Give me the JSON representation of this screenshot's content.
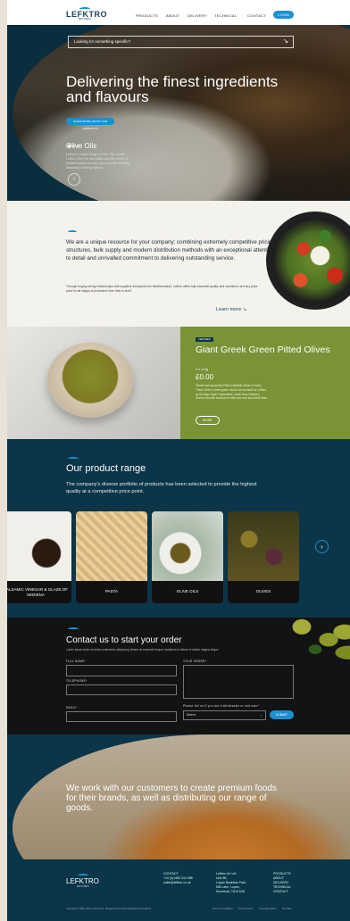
{
  "header": {
    "logo_text": "LEFKTRO",
    "logo_sub": "BROTHERS",
    "nav": [
      "PRODUCTS",
      "ABOUT",
      "DELIVERY",
      "TECHNICAL",
      "CONTACT"
    ],
    "login_label": "LOGIN"
  },
  "hero": {
    "search_placeholder": "Looking for something specific?",
    "title": "Delivering the finest ingredients and flavours",
    "button_label": "LEARN MORE ABOUT OUR PRODUCTS",
    "slide_title": "Olive Oils",
    "slide_desc": "Lefktro's unique range of Olive Oils, Greek Lefktro Olive Oil and Italian provide a best of Mediterranean culinary and cosmetic flexibility, delivering ordering options."
  },
  "about": {
    "text": "We are a unique resource for your company; combining extremely competitive pricing structures, bulk supply and modern distribution methods with an exceptional attention to detail and unrivalled commitment to delivering outstanding service.",
    "small": "Through forging strong relationships with suppliers throughout the Mediterranean, Lefktro offers fully traceable quality and excellence at every price point for all stages of production from field to shelf.",
    "learn_more": "Learn more"
  },
  "featured": {
    "badge": "FEATURED",
    "title": "Giant Greek Green Pitted Olives",
    "weight": "2 x 4 kg",
    "price": "£0.00",
    "desc": "Tender and succulent Pitted Halkidiki Olives in brine. These Green Greek green olives are sourced for Lefktro by the Agro Agra Cooperative, come from Northern Greece and are famous for their size and succulent flesh.",
    "more_label": "MORE"
  },
  "range": {
    "title": "Our product range",
    "desc": "The company's diverse portfolio of products has been selected to provide the highest quality at a competitive price point.",
    "cards": [
      {
        "label": "BALSAMIC VINEGAR & GLAZE OF MODENA",
        "color": "#c9a06a"
      },
      {
        "label": "PASTA",
        "color": "#e6c68e"
      },
      {
        "label": "OLIVE OILS",
        "color": "#9fb0a4"
      },
      {
        "label": "OLIVES",
        "color": "#6b5b2e"
      }
    ]
  },
  "contact": {
    "title": "Contact us to start your order",
    "sub": "Lorem ipsum dolor sit amet consectetur adipiscing elitsed do eiusmod tempor incididunt ut labore et dolore magna aliqua.",
    "full_name": "FULL NAME*",
    "your_order": "YOUR ORDER*",
    "telephone": "TELEPHONE*",
    "email": "EMAIL*",
    "wholesaler_q": "Please tell us if you are a wholesaler or end user*",
    "select_value": "Select",
    "submit_label": "SUBMIT"
  },
  "banner": {
    "text": "We work with our customers to create premium foods for their brands, as well as distributing our range of goods."
  },
  "footer": {
    "logo_text": "LEFKTRO",
    "logo_sub": "BROTHERS",
    "contact_heading": "CONTACT",
    "phone": "+44 (0)1480 242 588",
    "email": "sales@lefktro.co.uk",
    "address": [
      "Lefktro UK Ltd",
      "Unit 5B,",
      "Lupan Business Park,",
      "Mill Lane, Lupan,",
      "Somerset, TA13 5JD"
    ],
    "links": [
      "PRODUCTS",
      "ABOUT",
      "DELIVERY",
      "TECHNICAL",
      "CONTACT"
    ],
    "copyright": "Copyright © 2024 Lefktro Food Links. Designed and built by Marketing Innovations",
    "legal": [
      "Terms & Conditions",
      "Privacy Policy",
      "Copyright Notice",
      "Site Map"
    ]
  }
}
